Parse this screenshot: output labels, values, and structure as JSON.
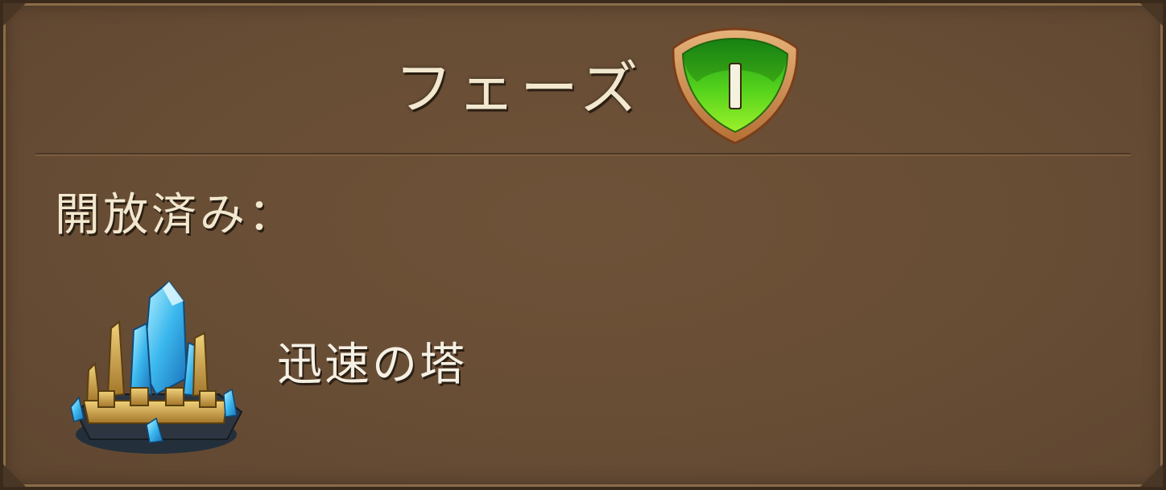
{
  "header": {
    "title": "フェーズ",
    "phase_numeral": "I"
  },
  "unlocked": {
    "label": "開放済み：",
    "items": [
      {
        "name": "迅速の塔",
        "icon": "crystal-tower-icon"
      }
    ]
  },
  "colors": {
    "panel": "#684d35",
    "text": "#f2e8cf",
    "badge_green": "#3fc21a",
    "badge_rim": "#c98a4a"
  }
}
